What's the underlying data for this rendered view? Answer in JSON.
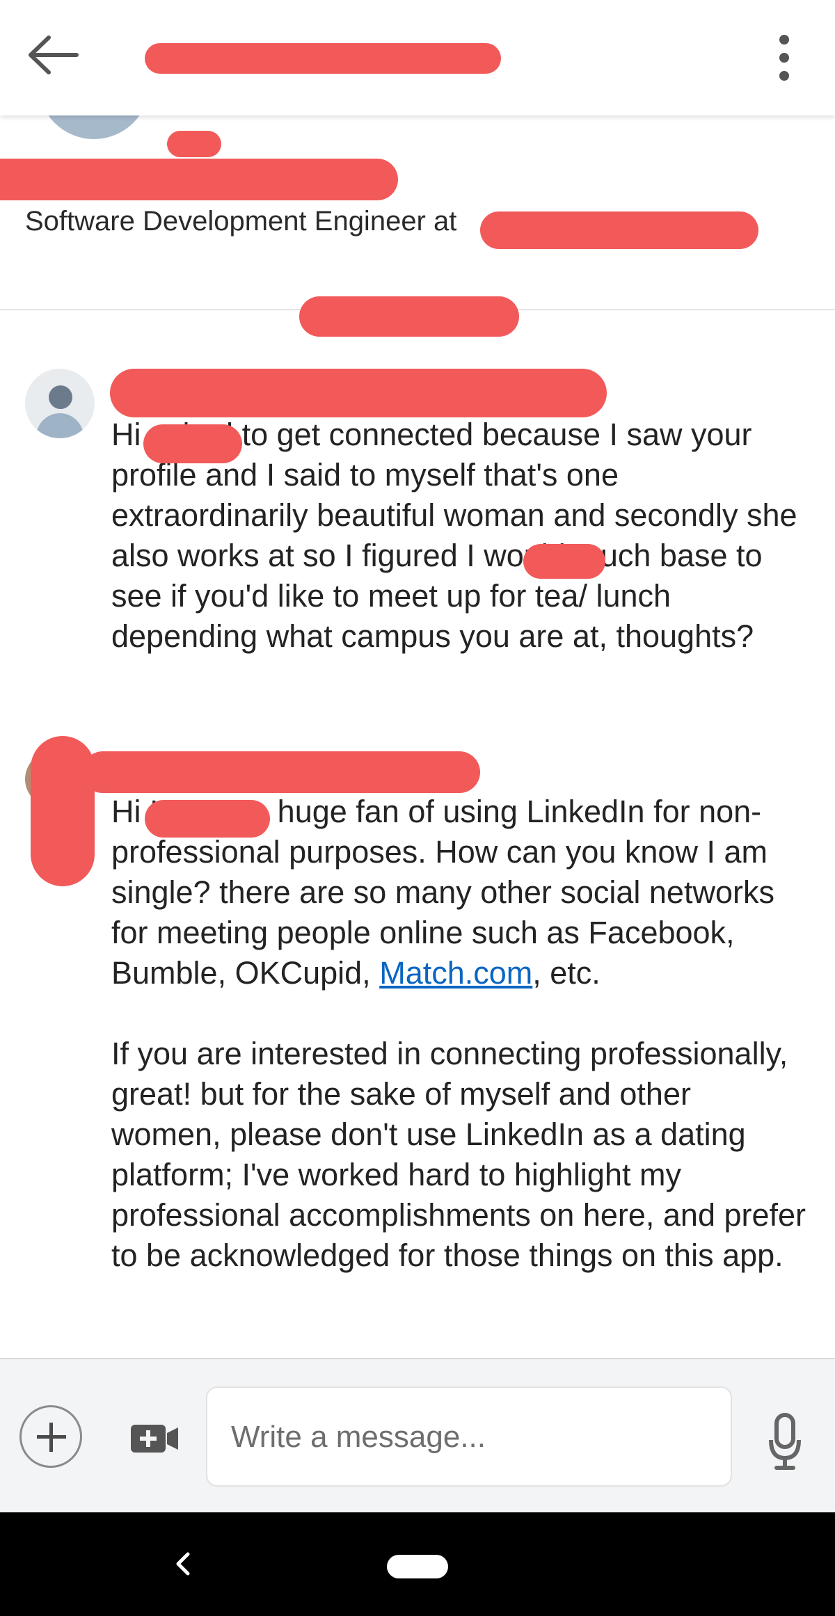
{
  "header": {
    "back_icon": "arrow-left-icon",
    "menu_icon": "more-vertical-icon"
  },
  "profile": {
    "headline": "Software Development Engineer at"
  },
  "messages": [
    {
      "text": "Hi asked to get connected because I saw your profile and I said to myself that's one extraordinarily beautiful woman and secondly she also works at so I figured I would touch base to see if you'd like to meet up for tea/ lunch depending what campus you are at, thoughts?"
    },
    {
      "text_1": "Hi I'm not a huge fan of using LinkedIn for non-professional purposes. How can you know I am single? there are so many other social networks for meeting people online such as Facebook, Bumble, OKCupid,",
      "link": "Match.com",
      "text_1_end": ", etc.",
      "text_2": "If you are interested in connecting professionally, great! but for the sake of myself and other women, please don't use LinkedIn as a dating platform; I've worked hard to highlight my professional accomplishments on here, and prefer to be acknowledged for those things on this app."
    }
  ],
  "composer": {
    "placeholder": "Write a message..."
  },
  "colors": {
    "redaction": "#f25a5a",
    "link": "#0a66c2",
    "avatar": "#a6b9cb"
  }
}
